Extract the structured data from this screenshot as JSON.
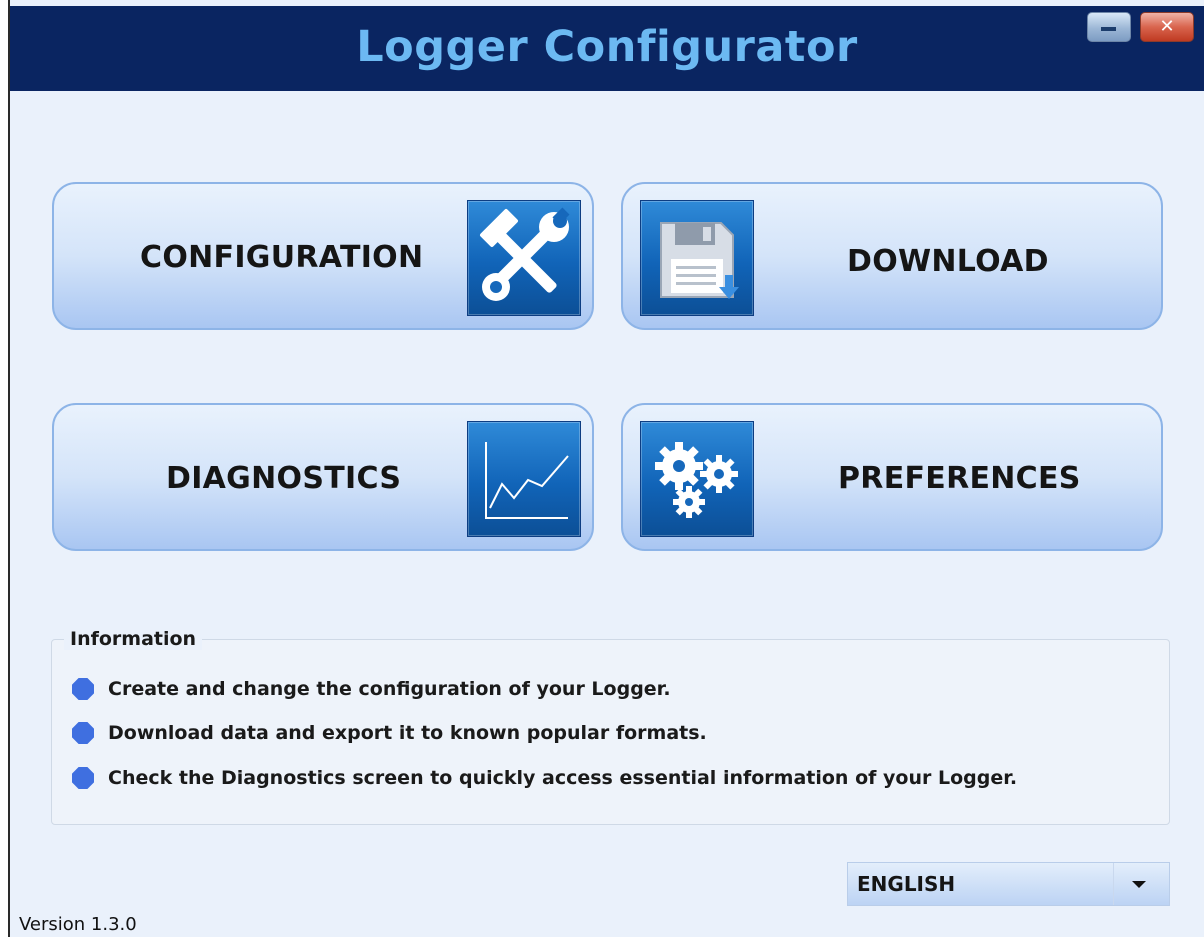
{
  "window": {
    "title": "Logger Configurator",
    "minimize_icon": "minimize-icon",
    "close_icon": "close-icon",
    "close_glyph": "✕"
  },
  "tiles": {
    "configuration": {
      "label": "CONFIGURATION",
      "icon": "tools-icon"
    },
    "download": {
      "label": "DOWNLOAD",
      "icon": "floppy-download-icon"
    },
    "diagnostics": {
      "label": "DIAGNOSTICS",
      "icon": "line-chart-icon"
    },
    "preferences": {
      "label": "PREFERENCES",
      "icon": "gears-icon"
    }
  },
  "information": {
    "title": "Information",
    "items": [
      "Create and change the configuration of your Logger.",
      "Download data and export it to known popular formats.",
      "Check the Diagnostics screen to quickly access essential information of your Logger."
    ]
  },
  "language": {
    "selected": "ENGLISH",
    "icon": "chevron-down-icon"
  },
  "footer": {
    "version": "Version 1.3.0"
  },
  "colors": {
    "title_bar": "#0a2561",
    "title_text": "#6cb9f2",
    "tile_border": "#8db4e7",
    "icon_blue": "#1164b8",
    "bullet": "#3f6fe0",
    "background": "#eaf1fb"
  }
}
